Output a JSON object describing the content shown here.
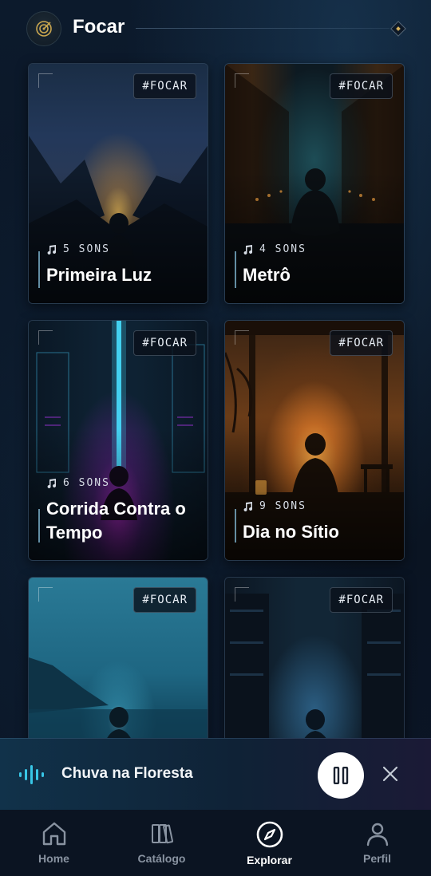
{
  "header": {
    "title": "Focar",
    "badge_icon": "target-icon",
    "menu_icon": "diamond-icon"
  },
  "cards": [
    {
      "tag": "#FOCAR",
      "count": "5 SONS",
      "name": "Primeira Luz",
      "theme": "mountain-sunrise"
    },
    {
      "tag": "#FOCAR",
      "count": "4 SONS",
      "name": "Metrô",
      "theme": "subway-station"
    },
    {
      "tag": "#FOCAR",
      "count": "6 SONS",
      "name": "Corrida Contra o Tempo",
      "theme": "neon-city"
    },
    {
      "tag": "#FOCAR",
      "count": "9 SONS",
      "name": "Dia no Sítio",
      "theme": "farm-sunset"
    },
    {
      "tag": "#FOCAR",
      "theme": "ocean-night"
    },
    {
      "tag": "#FOCAR",
      "theme": "library-night"
    }
  ],
  "player": {
    "title": "Chuva na Floresta",
    "state_icon": "pause-icon",
    "close_icon": "close-icon",
    "accent": "#38c6e6"
  },
  "nav": {
    "items": [
      {
        "label": "Home",
        "icon": "home-icon",
        "active": false
      },
      {
        "label": "Catálogo",
        "icon": "books-icon",
        "active": false
      },
      {
        "label": "Explorar",
        "icon": "compass-icon",
        "active": true
      },
      {
        "label": "Perfil",
        "icon": "person-icon",
        "active": false
      }
    ]
  }
}
